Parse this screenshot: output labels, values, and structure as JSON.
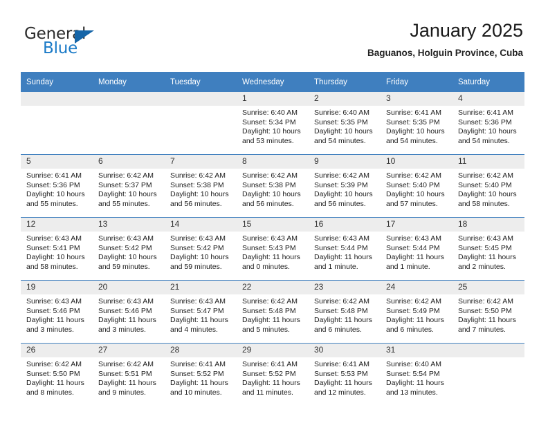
{
  "brand": {
    "name_part1": "General",
    "name_part2": "Blue",
    "accent_color": "#1a7ac7",
    "triangle_color": "#1565a8"
  },
  "header": {
    "title": "January 2025",
    "location": "Baguanos, Holguin Province, Cuba"
  },
  "theme": {
    "header_row_color": "#3f7fbf",
    "daynum_band_color": "#ededed",
    "text_color": "#1b1b1b"
  },
  "calendar": {
    "weekday_headers": [
      "Sunday",
      "Monday",
      "Tuesday",
      "Wednesday",
      "Thursday",
      "Friday",
      "Saturday"
    ],
    "weeks": [
      [
        {
          "day": "",
          "blank": true,
          "sunrise": "",
          "sunset": "",
          "daylight1": "",
          "daylight2": ""
        },
        {
          "day": "",
          "blank": true,
          "sunrise": "",
          "sunset": "",
          "daylight1": "",
          "daylight2": ""
        },
        {
          "day": "",
          "blank": true,
          "sunrise": "",
          "sunset": "",
          "daylight1": "",
          "daylight2": ""
        },
        {
          "day": "1",
          "sunrise": "Sunrise: 6:40 AM",
          "sunset": "Sunset: 5:34 PM",
          "daylight1": "Daylight: 10 hours",
          "daylight2": "and 53 minutes."
        },
        {
          "day": "2",
          "sunrise": "Sunrise: 6:40 AM",
          "sunset": "Sunset: 5:35 PM",
          "daylight1": "Daylight: 10 hours",
          "daylight2": "and 54 minutes."
        },
        {
          "day": "3",
          "sunrise": "Sunrise: 6:41 AM",
          "sunset": "Sunset: 5:35 PM",
          "daylight1": "Daylight: 10 hours",
          "daylight2": "and 54 minutes."
        },
        {
          "day": "4",
          "sunrise": "Sunrise: 6:41 AM",
          "sunset": "Sunset: 5:36 PM",
          "daylight1": "Daylight: 10 hours",
          "daylight2": "and 54 minutes."
        }
      ],
      [
        {
          "day": "5",
          "sunrise": "Sunrise: 6:41 AM",
          "sunset": "Sunset: 5:36 PM",
          "daylight1": "Daylight: 10 hours",
          "daylight2": "and 55 minutes."
        },
        {
          "day": "6",
          "sunrise": "Sunrise: 6:42 AM",
          "sunset": "Sunset: 5:37 PM",
          "daylight1": "Daylight: 10 hours",
          "daylight2": "and 55 minutes."
        },
        {
          "day": "7",
          "sunrise": "Sunrise: 6:42 AM",
          "sunset": "Sunset: 5:38 PM",
          "daylight1": "Daylight: 10 hours",
          "daylight2": "and 56 minutes."
        },
        {
          "day": "8",
          "sunrise": "Sunrise: 6:42 AM",
          "sunset": "Sunset: 5:38 PM",
          "daylight1": "Daylight: 10 hours",
          "daylight2": "and 56 minutes."
        },
        {
          "day": "9",
          "sunrise": "Sunrise: 6:42 AM",
          "sunset": "Sunset: 5:39 PM",
          "daylight1": "Daylight: 10 hours",
          "daylight2": "and 56 minutes."
        },
        {
          "day": "10",
          "sunrise": "Sunrise: 6:42 AM",
          "sunset": "Sunset: 5:40 PM",
          "daylight1": "Daylight: 10 hours",
          "daylight2": "and 57 minutes."
        },
        {
          "day": "11",
          "sunrise": "Sunrise: 6:42 AM",
          "sunset": "Sunset: 5:40 PM",
          "daylight1": "Daylight: 10 hours",
          "daylight2": "and 58 minutes."
        }
      ],
      [
        {
          "day": "12",
          "sunrise": "Sunrise: 6:43 AM",
          "sunset": "Sunset: 5:41 PM",
          "daylight1": "Daylight: 10 hours",
          "daylight2": "and 58 minutes."
        },
        {
          "day": "13",
          "sunrise": "Sunrise: 6:43 AM",
          "sunset": "Sunset: 5:42 PM",
          "daylight1": "Daylight: 10 hours",
          "daylight2": "and 59 minutes."
        },
        {
          "day": "14",
          "sunrise": "Sunrise: 6:43 AM",
          "sunset": "Sunset: 5:42 PM",
          "daylight1": "Daylight: 10 hours",
          "daylight2": "and 59 minutes."
        },
        {
          "day": "15",
          "sunrise": "Sunrise: 6:43 AM",
          "sunset": "Sunset: 5:43 PM",
          "daylight1": "Daylight: 11 hours",
          "daylight2": "and 0 minutes."
        },
        {
          "day": "16",
          "sunrise": "Sunrise: 6:43 AM",
          "sunset": "Sunset: 5:44 PM",
          "daylight1": "Daylight: 11 hours",
          "daylight2": "and 1 minute."
        },
        {
          "day": "17",
          "sunrise": "Sunrise: 6:43 AM",
          "sunset": "Sunset: 5:44 PM",
          "daylight1": "Daylight: 11 hours",
          "daylight2": "and 1 minute."
        },
        {
          "day": "18",
          "sunrise": "Sunrise: 6:43 AM",
          "sunset": "Sunset: 5:45 PM",
          "daylight1": "Daylight: 11 hours",
          "daylight2": "and 2 minutes."
        }
      ],
      [
        {
          "day": "19",
          "sunrise": "Sunrise: 6:43 AM",
          "sunset": "Sunset: 5:46 PM",
          "daylight1": "Daylight: 11 hours",
          "daylight2": "and 3 minutes."
        },
        {
          "day": "20",
          "sunrise": "Sunrise: 6:43 AM",
          "sunset": "Sunset: 5:46 PM",
          "daylight1": "Daylight: 11 hours",
          "daylight2": "and 3 minutes."
        },
        {
          "day": "21",
          "sunrise": "Sunrise: 6:43 AM",
          "sunset": "Sunset: 5:47 PM",
          "daylight1": "Daylight: 11 hours",
          "daylight2": "and 4 minutes."
        },
        {
          "day": "22",
          "sunrise": "Sunrise: 6:42 AM",
          "sunset": "Sunset: 5:48 PM",
          "daylight1": "Daylight: 11 hours",
          "daylight2": "and 5 minutes."
        },
        {
          "day": "23",
          "sunrise": "Sunrise: 6:42 AM",
          "sunset": "Sunset: 5:48 PM",
          "daylight1": "Daylight: 11 hours",
          "daylight2": "and 6 minutes."
        },
        {
          "day": "24",
          "sunrise": "Sunrise: 6:42 AM",
          "sunset": "Sunset: 5:49 PM",
          "daylight1": "Daylight: 11 hours",
          "daylight2": "and 6 minutes."
        },
        {
          "day": "25",
          "sunrise": "Sunrise: 6:42 AM",
          "sunset": "Sunset: 5:50 PM",
          "daylight1": "Daylight: 11 hours",
          "daylight2": "and 7 minutes."
        }
      ],
      [
        {
          "day": "26",
          "sunrise": "Sunrise: 6:42 AM",
          "sunset": "Sunset: 5:50 PM",
          "daylight1": "Daylight: 11 hours",
          "daylight2": "and 8 minutes."
        },
        {
          "day": "27",
          "sunrise": "Sunrise: 6:42 AM",
          "sunset": "Sunset: 5:51 PM",
          "daylight1": "Daylight: 11 hours",
          "daylight2": "and 9 minutes."
        },
        {
          "day": "28",
          "sunrise": "Sunrise: 6:41 AM",
          "sunset": "Sunset: 5:52 PM",
          "daylight1": "Daylight: 11 hours",
          "daylight2": "and 10 minutes."
        },
        {
          "day": "29",
          "sunrise": "Sunrise: 6:41 AM",
          "sunset": "Sunset: 5:52 PM",
          "daylight1": "Daylight: 11 hours",
          "daylight2": "and 11 minutes."
        },
        {
          "day": "30",
          "sunrise": "Sunrise: 6:41 AM",
          "sunset": "Sunset: 5:53 PM",
          "daylight1": "Daylight: 11 hours",
          "daylight2": "and 12 minutes."
        },
        {
          "day": "31",
          "sunrise": "Sunrise: 6:40 AM",
          "sunset": "Sunset: 5:54 PM",
          "daylight1": "Daylight: 11 hours",
          "daylight2": "and 13 minutes."
        },
        {
          "day": "",
          "blank": true,
          "sunrise": "",
          "sunset": "",
          "daylight1": "",
          "daylight2": ""
        }
      ]
    ]
  }
}
